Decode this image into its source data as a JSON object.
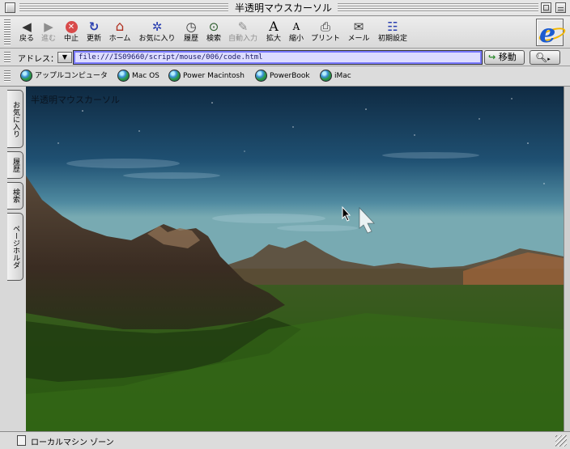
{
  "window": {
    "title": "半透明マウスカーソル"
  },
  "toolbar": {
    "buttons": [
      {
        "label": "戻る",
        "icon": "back-arrow-icon",
        "glyph": "◀"
      },
      {
        "label": "進む",
        "icon": "forward-arrow-icon",
        "glyph": "▶",
        "disabled": true
      },
      {
        "label": "中止",
        "icon": "stop-icon",
        "glyph": "✕"
      },
      {
        "label": "更新",
        "icon": "refresh-icon",
        "glyph": "↻"
      },
      {
        "label": "ホーム",
        "icon": "home-icon",
        "glyph": "⌂"
      },
      {
        "label": "お気に入り",
        "icon": "favorites-icon",
        "glyph": "✲"
      },
      {
        "label": "履歴",
        "icon": "history-icon",
        "glyph": "◷"
      },
      {
        "label": "検索",
        "icon": "search-icon",
        "glyph": "⊙"
      },
      {
        "label": "自動入力",
        "icon": "autofill-icon",
        "glyph": "✎",
        "disabled": true
      },
      {
        "label": "拡大",
        "icon": "text-larger-icon",
        "glyph": "A"
      },
      {
        "label": "縮小",
        "icon": "text-smaller-icon",
        "glyph": "A"
      },
      {
        "label": "プリント",
        "icon": "print-icon",
        "glyph": "⎙"
      },
      {
        "label": "メール",
        "icon": "mail-icon",
        "glyph": "✉"
      },
      {
        "label": "初期設定",
        "icon": "preferences-icon",
        "glyph": "☷"
      }
    ]
  },
  "address": {
    "label": "アドレス：",
    "url": "file:///IS09660/script/mouse/006/code.html",
    "go_label": "移動"
  },
  "favorites": [
    {
      "label": "アップルコンピュータ"
    },
    {
      "label": "Mac OS"
    },
    {
      "label": "Power Macintosh"
    },
    {
      "label": "PowerBook"
    },
    {
      "label": "iMac"
    }
  ],
  "sidetabs": [
    {
      "label": "お気に入り"
    },
    {
      "label": "履歴"
    },
    {
      "label": "検索"
    },
    {
      "label": "ページホルダ"
    }
  ],
  "content": {
    "heading": "半透明マウスカーソル"
  },
  "status": {
    "zone": "ローカルマシン ゾーン"
  },
  "colors": {
    "address_bg": "#dcdcff",
    "ie_blue": "#1b5bd0"
  }
}
